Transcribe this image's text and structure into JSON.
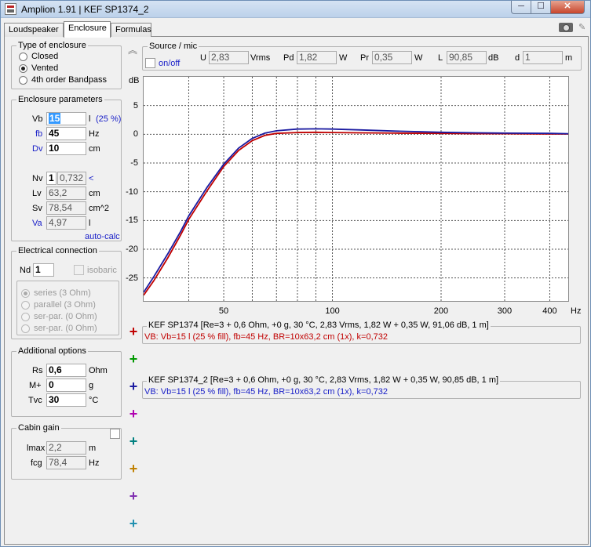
{
  "window": {
    "title": "Amplion 1.91 | KEF SP1374_2",
    "minimize": "─",
    "maximize": "☐",
    "close": "✕"
  },
  "tabs": [
    {
      "label": "Loudspeaker"
    },
    {
      "label": "Enclosure"
    },
    {
      "label": "Formulas"
    }
  ],
  "enclosure_type": {
    "title": "Type of enclosure",
    "options": [
      {
        "label": "Closed",
        "selected": false
      },
      {
        "label": "Vented",
        "selected": true
      },
      {
        "label": "4th order Bandpass",
        "selected": false
      }
    ]
  },
  "enclosure_params": {
    "title": "Enclosure parameters",
    "vb_label": "Vb",
    "vb_value": "15",
    "vb_unit": "l",
    "vb_fill": "(25 %)",
    "fb_label": "fb",
    "fb_value": "45",
    "fb_unit": "Hz",
    "dv_label": "Dv",
    "dv_value": "10",
    "dv_unit": "cm",
    "nv_label": "Nv",
    "nv_value": "1",
    "nv_k": "0,732",
    "nv_arrow": "<",
    "lv_label": "Lv",
    "lv_value": "63,2",
    "lv_unit": "cm",
    "sv_label": "Sv",
    "sv_value": "78,54",
    "sv_unit": "cm^2",
    "va_label": "Va",
    "va_value": "4,97",
    "va_unit": "l",
    "autocalc": "auto-calc"
  },
  "electrical": {
    "title": "Electrical connection",
    "nd_label": "Nd",
    "nd_value": "1",
    "isobaric": "isobaric",
    "options": [
      {
        "label": "series (3 Ohm)",
        "selected": true
      },
      {
        "label": "parallel (3 Ohm)",
        "selected": false
      },
      {
        "label": "ser-par. (0 Ohm)",
        "selected": false
      },
      {
        "label": "ser-par. (0 Ohm)",
        "selected": false
      }
    ]
  },
  "additional": {
    "title": "Additional options",
    "rs_label": "Rs",
    "rs_value": "0,6",
    "rs_unit": "Ohm",
    "m_label": "M+",
    "m_value": "0",
    "m_unit": "g",
    "tvc_label": "Tvc",
    "tvc_value": "30",
    "tvc_unit": "°C"
  },
  "cabin": {
    "title": "Cabin gain",
    "lmax_label": "lmax",
    "lmax_value": "2,2",
    "lmax_unit": "m",
    "fcg_label": "fcg",
    "fcg_value": "78,4",
    "fcg_unit": "Hz"
  },
  "source": {
    "title": "Source / mic",
    "onoff": "on/off",
    "u_label": "U",
    "u_value": "2,83",
    "u_unit": "Vrms",
    "pd_label": "Pd",
    "pd_value": "1,82",
    "pd_unit": "W",
    "pr_label": "Pr",
    "pr_value": "0,35",
    "pr_unit": "W",
    "l_label": "L",
    "l_value": "90,85",
    "l_unit": "dB",
    "d_label": "d",
    "d_value": "1",
    "d_unit": "m"
  },
  "collapse_icon": "︽",
  "icons": {
    "camera": "camera-icon",
    "pin": "pin-icon"
  },
  "chart_data": {
    "type": "line",
    "ylabel": "dB",
    "xlabel": "Hz",
    "xscale": "log",
    "xlim": [
      30,
      450
    ],
    "ylim": [
      -29,
      10
    ],
    "y_ticks": [
      5,
      0,
      -5,
      -10,
      -15,
      -20,
      -25
    ],
    "x_ticks": [
      {
        "v": 50,
        "label": "50"
      },
      {
        "v": 100,
        "label": "100"
      },
      {
        "v": 200,
        "label": "200"
      },
      {
        "v": 300,
        "label": "300"
      },
      {
        "v": 400,
        "label": "400"
      }
    ],
    "x_grid": [
      40,
      50,
      60,
      70,
      80,
      90,
      100,
      200,
      300,
      400
    ],
    "y_grid": [
      5,
      0,
      -5,
      -10,
      -15,
      -20,
      -25
    ],
    "series": [
      {
        "name": "KEF SP1374",
        "color": "#c00000",
        "x": [
          30,
          32,
          35,
          38,
          40,
          45,
          50,
          55,
          60,
          65,
          70,
          80,
          90,
          100,
          120,
          150,
          200,
          250,
          300,
          400,
          450
        ],
        "y": [
          -28,
          -25.5,
          -21.5,
          -17.5,
          -14.8,
          -9.8,
          -5.6,
          -2.8,
          -1.1,
          -0.2,
          0.15,
          0.3,
          0.35,
          0.3,
          0.25,
          0.2,
          0.15,
          0.1,
          0.1,
          0.05,
          0.05
        ]
      },
      {
        "name": "KEF SP1374_2",
        "color": "#1a1aa0",
        "x": [
          30,
          32,
          35,
          38,
          40,
          45,
          50,
          55,
          60,
          65,
          70,
          80,
          90,
          100,
          120,
          150,
          200,
          250,
          300,
          400,
          450
        ],
        "y": [
          -27.5,
          -24.8,
          -20.8,
          -16.9,
          -14.2,
          -9.2,
          -5.2,
          -2.4,
          -0.7,
          0.2,
          0.6,
          0.9,
          0.95,
          0.9,
          0.75,
          0.55,
          0.35,
          0.25,
          0.2,
          0.15,
          0.1
        ]
      }
    ]
  },
  "legend": [
    {
      "title": "KEF SP1374 [Re=3 + 0,6 Ohm, +0 g, 30 °C, 2,83 Vrms, 1,82 W + 0,35 W, 91,06 dB, 1 m]",
      "sub": "VB: Vb=15 l (25 % fill), fb=45 Hz, BR=10x63,2 cm (1x), k=0,732",
      "color": "#c00000"
    },
    {
      "title": "KEF SP1374_2 [Re=3 + 0,6 Ohm, +0 g, 30 °C, 2,83 Vrms, 1,82 W + 0,35 W, 90,85 dB, 1 m]",
      "sub": "VB: Vb=15 l (25 % fill), fb=45 Hz, BR=10x63,2 cm (1x), k=0,732",
      "color": "#1a20c8"
    }
  ],
  "plus_buttons": [
    {
      "symbol": "+",
      "color": "#c00000"
    },
    {
      "symbol": "+",
      "color": "#009900"
    },
    {
      "symbol": "+",
      "color": "#1a1aa0"
    },
    {
      "symbol": "+",
      "color": "#b000b0"
    },
    {
      "symbol": "+",
      "color": "#008080"
    },
    {
      "symbol": "+",
      "color": "#c08000"
    },
    {
      "symbol": "+",
      "color": "#8030b0"
    },
    {
      "symbol": "+",
      "color": "#2090b0"
    }
  ]
}
